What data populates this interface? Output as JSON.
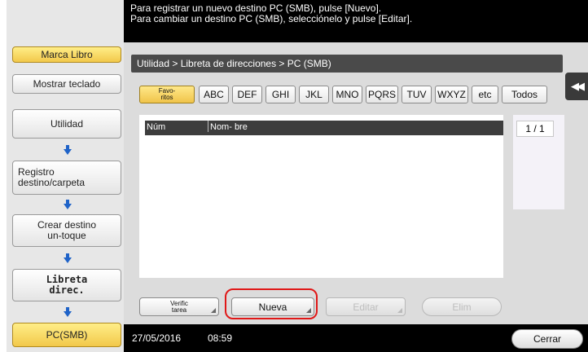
{
  "message": {
    "line1": "Para registrar un nuevo destino PC (SMB), pulse [Nuevo].",
    "line2": "Para cambiar un destino PC (SMB), selecciónelo y pulse [Editar]."
  },
  "sidebar": {
    "marca_libro": "Marca Libro",
    "mostrar_teclado": "Mostrar teclado",
    "steps": [
      {
        "line1": "Utilidad",
        "line2": ""
      },
      {
        "line1": "Registro",
        "line2": "destino/carpeta"
      },
      {
        "line1": "Crear destino",
        "line2": "un-toque"
      },
      {
        "line1": "Libreta",
        "line2": "direc."
      },
      {
        "line1": "PC(SMB)",
        "line2": ""
      }
    ]
  },
  "breadcrumb": "Utilidad > Libreta de direcciones > PC (SMB)",
  "tabs": {
    "favoritos_line1": "Favo-",
    "favoritos_line2": "ritos",
    "items": [
      "ABC",
      "DEF",
      "GHI",
      "JKL",
      "MNO",
      "PQRS",
      "TUV",
      "WXYZ",
      "etc",
      "Todos"
    ]
  },
  "list": {
    "col_num": "Núm",
    "col_name": "Nom- bre"
  },
  "page_indicator": "1 / 1",
  "buttons": {
    "verific_line1": "Verific",
    "verific_line2": "tarea",
    "nueva": "Nueva",
    "editar": "Editar",
    "elim": "Elim",
    "cerrar": "Cerrar"
  },
  "status": {
    "date": "27/05/2016",
    "time": "08:59"
  },
  "colors": {
    "accent_yellow": "#f2c84a",
    "arrow_blue": "#1f63c8",
    "highlight_red": "#e01818"
  }
}
